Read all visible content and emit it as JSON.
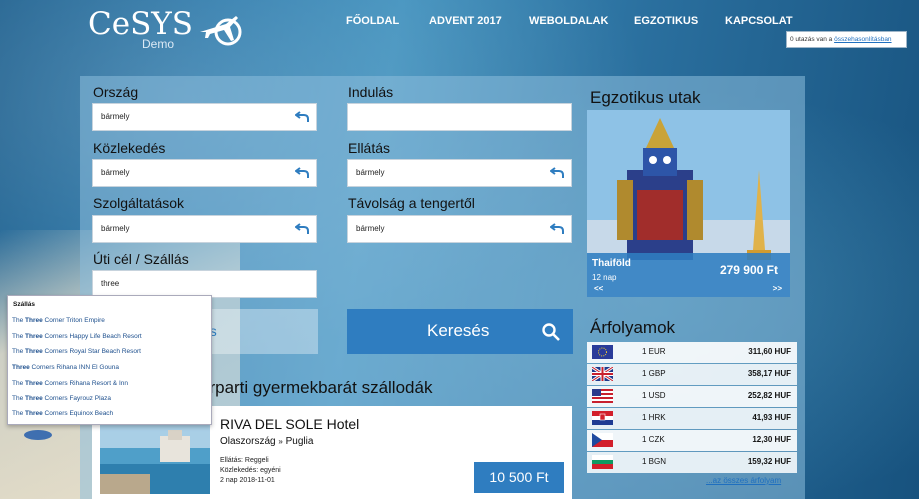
{
  "header": {
    "logo_text": "CeSYS",
    "logo_sub": "Demo",
    "nav": [
      "FŐOLDAL",
      "ADVENT 2017",
      "WEBOLDALAK",
      "EGZOTIKUS",
      "KAPCSOLAT"
    ],
    "compare_count": "0 utazás van a",
    "compare_link": "összehasonlításban"
  },
  "search": {
    "labels": {
      "country": "Ország",
      "departure": "Indulás",
      "transport": "Közlekedés",
      "board": "Ellátás",
      "services": "Szolgáltatások",
      "distance": "Távolság a tengertől",
      "destination": "Úti cél / Szállás"
    },
    "values": {
      "country": "bármely",
      "departure": "",
      "transport": "bármely",
      "board": "bármely",
      "services": "bármely",
      "distance": "bármely",
      "destination": "three"
    },
    "hidden_button_label": "es",
    "search_button_label": "Keresés"
  },
  "autocomplete": {
    "header": "Szállás",
    "items": [
      {
        "before": "The ",
        "match": "Three",
        "after": " Corner Triton Empire"
      },
      {
        "before": "The ",
        "match": "Three",
        "after": " Corners Happy Life Beach Resort"
      },
      {
        "before": "The ",
        "match": "Three",
        "after": " Corners Royal Star Beach Resort"
      },
      {
        "before": "",
        "match": "Three",
        "after": " Corners Rihana INN El Gouna"
      },
      {
        "before": "The ",
        "match": "Three",
        "after": " Corners Rihana Resort & Inn"
      },
      {
        "before": "The ",
        "match": "Three",
        "after": " Corners Fayrouz Plaza"
      },
      {
        "before": "The ",
        "match": "Three",
        "after": " Corners Equinox Beach"
      }
    ]
  },
  "main": {
    "section_title": "erparti gyermekbarát szállodák",
    "hotel": {
      "name": "RIVA DEL SOLE Hotel",
      "country": "Olaszország",
      "separator": "»",
      "region": "Puglia",
      "board": "Ellátás: Reggeli",
      "transport": "Közlekedés: egyéni",
      "duration": "2 nap 2018-11-01",
      "price": "10 500 Ft"
    }
  },
  "exotic": {
    "title": "Egzotikus utak",
    "destination": "Thaiföld",
    "days": "12 nap",
    "price": "279 900 Ft",
    "prev": "<<",
    "next": ">>"
  },
  "fx": {
    "title": "Árfolyamok",
    "rows": [
      {
        "amount": "1 EUR",
        "rate": "311,60 HUF",
        "flag": "eu-flag-icon"
      },
      {
        "amount": "1 GBP",
        "rate": "358,17 HUF",
        "flag": "uk-flag-icon"
      },
      {
        "amount": "1 USD",
        "rate": "252,82 HUF",
        "flag": "us-flag-icon"
      },
      {
        "amount": "1 HRK",
        "rate": "41,93 HUF",
        "flag": "hr-flag-icon"
      },
      {
        "amount": "1 CZK",
        "rate": "12,30 HUF",
        "flag": "cz-flag-icon"
      },
      {
        "amount": "1 BGN",
        "rate": "159,32 HUF",
        "flag": "bg-flag-icon"
      }
    ],
    "all_link": "...az összes árfolyam"
  },
  "colors": {
    "accent": "#2f7dc0",
    "link": "#1f6fbf"
  }
}
